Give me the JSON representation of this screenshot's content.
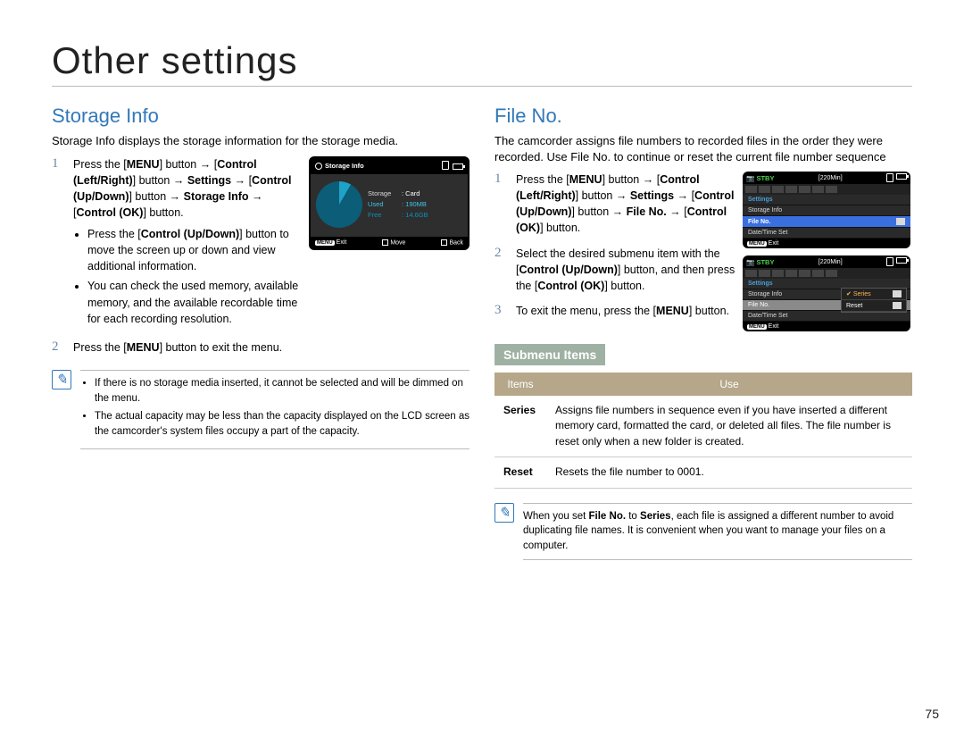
{
  "page_title": "Other settings",
  "page_number": "75",
  "storage": {
    "heading": "Storage Info",
    "intro": "Storage Info displays the storage information for the storage media.",
    "step1": {
      "num": "1",
      "line1a": "Press the [",
      "line1b": "MENU",
      "line1c": "] button → [",
      "line1d": "Control (Left/Right)",
      "line1e": "] button → ",
      "line1f": "Settings",
      "line1g": " → [",
      "line1h": "Control (Up/Down)",
      "line1i": "] button → ",
      "line1j": "Storage Info",
      "line1k": " → [",
      "line1l": "Control (OK)",
      "line1m": "] button.",
      "bullet1a": "Press the [",
      "bullet1b": "Control (Up/Down)",
      "bullet1c": "] button to move the screen up or down and view additional information.",
      "bullet2": "You can check the used memory, available memory, and the available recordable time for each recording resolution."
    },
    "step2": {
      "num": "2",
      "texta": "Press the [",
      "textb": "MENU",
      "textc": "] button to exit the menu."
    },
    "notes": {
      "b1": "If there is no storage media inserted, it cannot be selected and will be dimmed on the menu.",
      "b2": "The actual capacity may be less than the capacity displayed on the LCD screen as the camcorder's system files occupy a part of the capacity."
    },
    "device": {
      "title": "Storage Info",
      "storage_label": "Storage",
      "storage_value": ": Card",
      "used_label": "Used",
      "used_value": ": 190MB",
      "free_label": "Free",
      "free_value": ": 14.6GB",
      "exit_key": "MENU",
      "exit": "Exit",
      "move": "Move",
      "back": "Back"
    }
  },
  "fileno": {
    "heading": "File No.",
    "intro": "The camcorder assigns file numbers to recorded files in the order they were recorded. Use File No. to continue or reset the current file number sequence",
    "step1": {
      "num": "1",
      "a": "Press the [",
      "b": "MENU",
      "c": "] button → [",
      "d": "Control (Left/Right)",
      "e": "] button → ",
      "f": "Settings",
      "g": " → [",
      "h": "Control (Up/Down)",
      "i": "] button → ",
      "j": "File No.",
      "k": " → [",
      "l": "Control (OK)",
      "m": "] button."
    },
    "step2": {
      "num": "2",
      "a": "Select the desired submenu item with the [",
      "b": "Control (Up/Down)",
      "c": "] button, and then press the [",
      "d": "Control (OK)",
      "e": "] button."
    },
    "step3": {
      "num": "3",
      "a": "To exit the menu, press the [",
      "b": "MENU",
      "c": "] button."
    },
    "submenu_head": "Submenu Items",
    "table": {
      "col1": "Items",
      "col2": "Use",
      "r1name": "Series",
      "r1use": "Assigns file numbers in sequence even if you have inserted a different memory card, formatted the card, or deleted all files. The file number is reset only when a new folder is created.",
      "r2name": "Reset",
      "r2use": "Resets the file number to 0001."
    },
    "note": {
      "a": "When you set ",
      "b": "File No.",
      "c": " to ",
      "d": "Series",
      "e": ", each file is assigned a different number to avoid duplicating file names. It is convenient when you want to manage your files on a computer."
    },
    "screen1": {
      "stby": "STBY",
      "min": "[220Min]",
      "settings": "Settings",
      "row_storage": "Storage Info",
      "row_fileno": "File No.",
      "row_datetime": "Date/Time Set",
      "exit_key": "MENU",
      "exit": "Exit"
    },
    "screen2": {
      "stby": "STBY",
      "min": "[220Min]",
      "settings": "Settings",
      "row_storage": "Storage Info",
      "row_fileno": "File No.",
      "row_datetime": "Date/Time Set",
      "menu_series": "Series",
      "menu_reset": "Reset",
      "exit_key": "MENU",
      "exit": "Exit"
    }
  },
  "chart_data": {
    "type": "pie",
    "title": "Storage Info",
    "series": [
      {
        "name": "Used",
        "value_label": "190MB"
      },
      {
        "name": "Free",
        "value_label": "14.6GB"
      }
    ],
    "storage": "Card"
  }
}
